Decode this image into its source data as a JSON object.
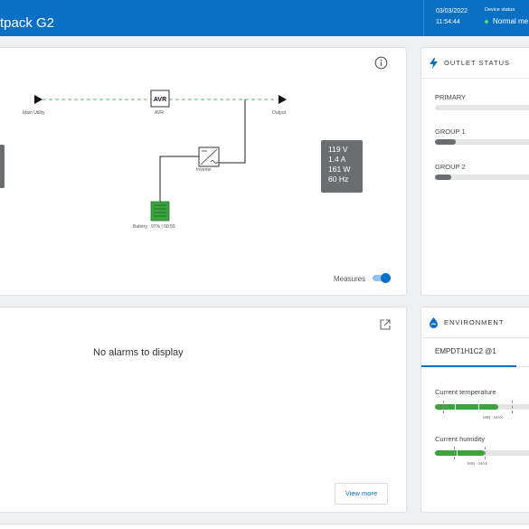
{
  "header": {
    "title": "tpack G2",
    "date": "03/03/2022",
    "time": "11:54:44",
    "status_label": "Device status:",
    "status_value": "Normal me",
    "status_color": "#5cd65c",
    "accent": "#0b6fc4"
  },
  "flow": {
    "nodes": {
      "main_utility": "Main Utility",
      "avr_box": "AVR",
      "avr": "AVR",
      "output": "Output",
      "inverter": "Inverter",
      "battery": "Battery : 97% | 00:59"
    },
    "measures": {
      "voltage": "119 V",
      "current": "1.4 A",
      "power": "161 W",
      "frequency": "60 Hz"
    },
    "measures_toggle_label": "Measures",
    "measures_toggle_on": true,
    "info_icon": "info-icon"
  },
  "outlet_status": {
    "title": "OUTLET STATUS",
    "icon": "lightning-icon",
    "groups": [
      {
        "label": "PRIMARY",
        "fill": 0.0
      },
      {
        "label": "GROUP 1",
        "fill": 0.19
      },
      {
        "label": "GROUP 2",
        "fill": 0.15
      }
    ]
  },
  "alarms": {
    "empty_message": "No alarms to display",
    "view_more_label": "View more",
    "open_icon": "external-link-icon"
  },
  "environment": {
    "title": "ENVIRONMENT",
    "icon": "water-drop-icon",
    "tab": "EMPDT1H1C2 @1",
    "temperature": {
      "label": "Current temperature",
      "minmax": "MIN - MAX",
      "fill": 0.58
    },
    "humidity": {
      "label": "Current humidity",
      "minmax": "MIN - MAX",
      "fill": 0.46
    }
  }
}
